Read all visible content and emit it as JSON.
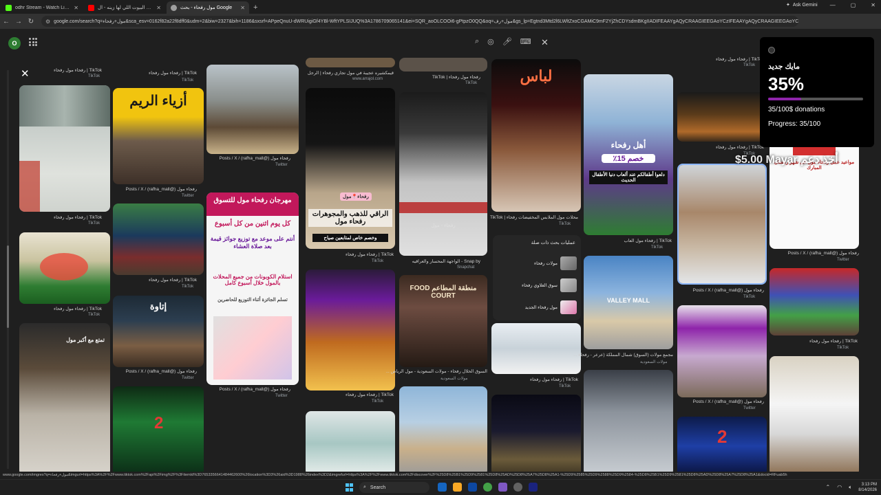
{
  "browser": {
    "tabs": [
      {
        "title": "odhr Stream - Watch Live on Ki",
        "favicon_color": "#53fc18"
      },
      {
        "title": "يا دار وين البيوت اللي لها زينه - ال",
        "favicon_color": "#ff0000"
      },
      {
        "title": "مول رفحاء - بحث Google",
        "favicon_color": "#9e9e9e"
      }
    ],
    "new_tab": "+",
    "ask_gemini": "Ask Gemini",
    "url": "google.com/search?q=مول+رفحاء&sca_esv=0162f82a22f8dff0&udm=2&biw=2327&bih=1186&sxsrf=APpeQnuU-dWRUigiGf4YBl-WftYPLSIJUQ%3A1786709065141&ei=SQR_aoOLCOOi6-gPtpzO0QQ&oq=مول+رف&gs_lp=Egtnd3Mtd2l6LWltZxoCGAMiC9mF2YjZhCDYsdmBKgIIADIFEAAYgAQyCRAAGIEEGAoYCzIFEAAYgAQyCRAAGIEEGAoYCzIF"
  },
  "page": {
    "close_label": "✕",
    "avatar_letter": "O"
  },
  "captions": {
    "c1": "TikTok | رفحاء مول رفحاء",
    "c1s": "TikTok",
    "c2": "TikTok | رفحاء مول رفحاء",
    "c2s": "TikTok",
    "c3": "TikTok | رفحاء مول رفحاء",
    "c3s": "TikTok",
    "c4": "رفحاء مول (@rafha_mall) / Posts / X",
    "c4s": "Twitter",
    "c5": "TikTok | رفحاء مول رفحاء",
    "c5s": "TikTok",
    "c6": "رفحاء مول (@rafha_mall) / Posts / X",
    "c6s": "Twitter",
    "c7": "رفحاء مول (@rafha_mall) / Posts / X",
    "c7s": "Twitter",
    "c8": "رفحاء مول (@rafha_mall) / Posts / X",
    "c8s": "Twitter",
    "c9": "TikTok | رفحاء مول رفحاء",
    "c9s": "TikTok",
    "c10": "TikTok | رفحاء مول رفحاء",
    "c10s": "TikTok",
    "c11": "Snap by - الواجهة المحسار والعراقيه",
    "c11s": "Snapchat",
    "c12": "السوق الحلال رفحاء - مولات السعودية - مول الرياض ...",
    "c12s": "مولات السعودية",
    "c13": "محلات مول الملابس المخفيضات رفحاء | TikTok",
    "c13s": "TikTok",
    "c14": "TikTok | رفحاء مول رفحاء",
    "c14s": "TikTok",
    "c15": "TikTok | رفحاء مول العاب",
    "c15s": "TikTok",
    "c16": "مجمع مولات (السوق) شمال المملكة (عرعر - رفحاء ...",
    "c16s": "مولات السعودية",
    "c17": "TikTok | رفحاء مول رفحاء",
    "c17s": "TikTok",
    "c18": "رفحاء مول (@rafha_mall) / Posts / X",
    "c18s": "Twitter",
    "c19": "رفحاء مول (@rafha_mall) / Posts / X",
    "c19s": "Twitter",
    "c20": "رفحاء مول (@rafha_mall) / Posts / X",
    "c20s": "Twitter",
    "c21": "TikTok | رفحاء مول رفحاء",
    "c21s": "TikTok",
    "c22": "TikTok | رفحاء مول رفحاء",
    "c22s": "TikTok",
    "c_top1": "قيمكشيره عجيبة في مول تجاري رفحاء | الرجل",
    "c_top1s": "www.arrajol.com",
    "c_top2": "رفحاء مول رفحاء | TikTok",
    "c_top3": "TikTok | رفحاء مول رفحاء",
    "c_top4": "TikTok | رفحاء مول رفحاء"
  },
  "overlays": {
    "naseem": "أزياء الريم",
    "festival_title": "مهرجان رفحاء مول للتسوق",
    "festival_sub": "كل يوم اثنين من كل أسبوع",
    "festival_body": "أنتم على موعد مع توزيع جوائز قيمة بعد صلاة العشاء",
    "festival_note": "استلام الكوبونات من جميع المحلات بالمول خلال أسبوع كامل",
    "festival_note2": "تسلم الجائزة أثناء التوزيع للحاضرين",
    "gold_tag": "رفحاء📍مول",
    "gold_title": "الراقي للذهب والمجوهرات رفحاء مول",
    "gold_sub": "وخصم خاص لمتابعين صياح",
    "clothes": "لباس",
    "ahlan": "أهل رفحاء",
    "discount": "خصم 15٪",
    "kids_note": "دلعوا أطفالكم عند ألعاب دنيا الأطفال الحديث",
    "food_court": "منطقة المطاعم FOOD COURT",
    "valley": "VALLEY MALL",
    "tamatt": "تمتع مع أكبر مول",
    "utawa": "إتاوة",
    "prayer_title": "مواعيد عمل رفحاء مول في شهر رمضان المبارك",
    "snap_label": "رفحاء - مول"
  },
  "related": {
    "heading": "عمليات بحث ذات صلة",
    "items": [
      {
        "label": "مولات رفحاء"
      },
      {
        "label": "سوق الغلاوي رفحاء"
      },
      {
        "label": "مول رفحاء الجديد"
      }
    ]
  },
  "donation": {
    "name": "مايك جديد",
    "percent_label": "35%",
    "percent": 0.35,
    "amount": "35/100$ donations",
    "progress": "Progress: 35/100",
    "ticker": "$5.00 Mayar أخذ دعم"
  },
  "statusbar": {
    "url": "www.google.com/imgres?q=مول+رفحاء&imgurl=https%3A%2F%2Fwww.tiktok.com%2Fapi%2Fimg%2F%3FitemId%3D7653356641484462600%26location%3D3%26aid%3D1988%26index%3D2&imgrefurl=https%3A%2F%2Fwww.tiktok.com%2Fdiscover%2F%25D8%25B1%25D9%2581%25D8%25AD%25D8%25A7%25D8%25A1-%25D9%2585%25D9%2588%25D9%2584-%25D8%25B1%25D9%2581%25D8%25AD%25D8%25A7%25D8%25A1&docid=RFuab5h"
  },
  "taskbar": {
    "search": "Search",
    "time": "3:13 PM",
    "date": "8/14/2026"
  }
}
